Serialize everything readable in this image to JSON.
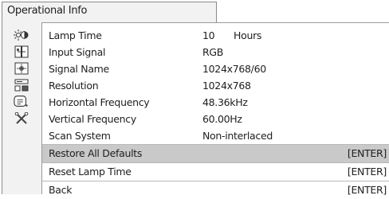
{
  "menu": {
    "title": "Operational Info"
  },
  "info_rows": [
    {
      "label": "Lamp Time",
      "value": "10",
      "unit": "Hours"
    },
    {
      "label": "Input Signal",
      "value": "RGB"
    },
    {
      "label": "Signal Name",
      "value": "1024x768/60"
    },
    {
      "label": "Resolution",
      "value": "1024x768"
    },
    {
      "label": "Horizontal Frequency",
      "value": "48.36kHz"
    },
    {
      "label": "Vertical Frequency",
      "value": "60.00Hz"
    },
    {
      "label": "Scan System",
      "value": "Non-interlaced"
    }
  ],
  "actions": [
    {
      "label": "Restore All Defaults",
      "key": "[ENTER]",
      "selected": true
    },
    {
      "label": "Reset Lamp Time",
      "key": "[ENTER]"
    },
    {
      "label": "Back",
      "key": "[ENTER]"
    }
  ],
  "sidebar_icons": [
    "brightness-icon",
    "picture-adjust-icon",
    "image-settings-icon",
    "setup-icon",
    "info-icon",
    "tools-icon"
  ]
}
